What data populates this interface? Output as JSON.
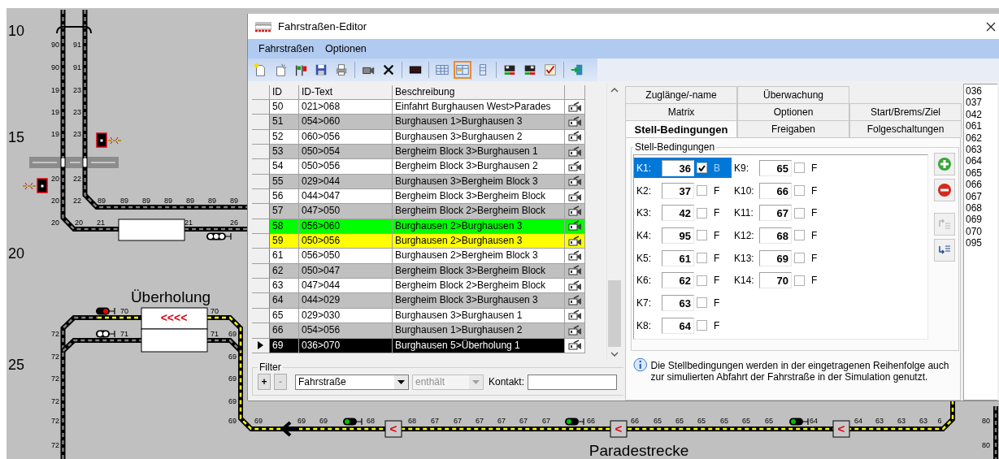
{
  "diagram": {
    "grid_rows": [
      "10",
      "15",
      "20",
      "25"
    ],
    "track_numbers": [
      "90",
      "91",
      "90",
      "91",
      "19",
      "23",
      "19",
      "23",
      "19",
      "23",
      "20",
      "22",
      "20",
      "22",
      "89",
      "89",
      "89",
      "89",
      "89",
      "89",
      "89",
      "20",
      "20",
      "21",
      "21",
      "26",
      "70",
      "70",
      "72",
      "71",
      "71",
      "69",
      "72",
      "69",
      "72",
      "69",
      "72",
      "69",
      "72",
      "69",
      "69",
      "69",
      "69",
      "68",
      "68",
      "67",
      "67",
      "67",
      "67",
      "67",
      "67",
      "66",
      "66",
      "65",
      "65",
      "65",
      "65",
      "65",
      "65",
      "64",
      "64",
      "63",
      "63",
      "63",
      "6",
      "80",
      "72",
      "80"
    ],
    "station_names": [
      "Überholung",
      "Paradestrecke"
    ],
    "route_marker": "<<<<",
    "block_markers": [
      "<",
      "<",
      "<"
    ]
  },
  "window": {
    "title": "Fahrstraßen-Editor"
  },
  "menu": [
    "Fahrstraßen",
    "Optionen"
  ],
  "toolbar": [
    {
      "selected": false
    },
    {
      "selected": false
    },
    {
      "selected": false
    },
    {
      "selected": false
    },
    {
      "selected": false
    },
    {
      "selected": false
    },
    {
      "selected": false
    },
    {
      "selected": false
    },
    {
      "selected": false
    },
    {
      "selected": true
    },
    {
      "selected": false
    },
    {
      "selected": false
    },
    {
      "selected": false
    },
    {
      "selected": false
    },
    {
      "selected": false
    }
  ],
  "table": {
    "columns": [
      "ID",
      "ID-Text",
      "Beschreibung"
    ],
    "rows": [
      {
        "id": "50",
        "id_text": "021>068",
        "description": "Einfahrt Burghausen West>Parades",
        "selected": false
      },
      {
        "id": "51",
        "id_text": "054>060",
        "description": "Burghausen 1>Burghausen 3",
        "selected": false
      },
      {
        "id": "52",
        "id_text": "060>056",
        "description": "Burghausen 3>Burghausen 2",
        "selected": false
      },
      {
        "id": "53",
        "id_text": "050>054",
        "description": "Bergheim Block 3>Burghausen 1",
        "selected": false
      },
      {
        "id": "54",
        "id_text": "050>056",
        "description": "Bergheim Block 3>Burghausen 2",
        "selected": false
      },
      {
        "id": "55",
        "id_text": "029>044",
        "description": "Burghausen 3>Bergheim Block 3",
        "selected": false
      },
      {
        "id": "56",
        "id_text": "044>047",
        "description": "Bergheim Block 3>Bergheim Block",
        "selected": false
      },
      {
        "id": "57",
        "id_text": "047>050",
        "description": "Bergheim Block 2>Bergheim Block",
        "selected": false
      },
      {
        "id": "58",
        "id_text": "056>060",
        "description": "Burghausen 2>Burghausen 3",
        "selected": false,
        "color": "#00ff00"
      },
      {
        "id": "59",
        "id_text": "050>056",
        "description": "Burghausen 2>Burghausen 3",
        "selected": false,
        "color": "#ffff00"
      },
      {
        "id": "61",
        "id_text": "056>050",
        "description": "Burghausen 2>Bergheim Block 3",
        "selected": false
      },
      {
        "id": "62",
        "id_text": "050>047",
        "description": "Bergheim Block 3>Bergheim Block",
        "selected": false
      },
      {
        "id": "63",
        "id_text": "047>044",
        "description": "Bergheim Block 2>Bergheim Block",
        "selected": false
      },
      {
        "id": "64",
        "id_text": "044>029",
        "description": "Bergheim Block 3>Burghausen 3",
        "selected": false
      },
      {
        "id": "65",
        "id_text": "029>030",
        "description": "Burghausen 3>Burghausen 1",
        "selected": false
      },
      {
        "id": "66",
        "id_text": "054>056",
        "description": "Burghausen 1>Burghausen 2",
        "selected": false
      },
      {
        "id": "69",
        "id_text": "036>070",
        "description": "Burghausen 5>Überholung 1",
        "selected": true
      }
    ]
  },
  "filter": {
    "legend": "Filter",
    "add": {
      "label": "+"
    },
    "remove": {
      "label": "-",
      "disabled": true
    },
    "field": {
      "value": "Fahrstraße"
    },
    "operator": {
      "value": "enthält",
      "disabled": true
    },
    "contact": {
      "label": "Kontakt:"
    }
  },
  "tabs": [
    [
      {
        "label": "Zuglänge/-name",
        "selected": false
      },
      {
        "label": "Überwachung",
        "selected": false
      }
    ],
    [
      {
        "label": "Matrix",
        "selected": false
      },
      {
        "label": "Optionen",
        "selected": false
      },
      {
        "label": "Start/Brems/Ziel",
        "selected": false
      }
    ],
    [
      {
        "label": "Stell-Bedingungen",
        "selected": true
      },
      {
        "label": "Freigaben",
        "selected": false
      },
      {
        "label": "Folgeschaltungen",
        "selected": false
      }
    ]
  ],
  "conditions": {
    "title": "Stell-Bedingungen",
    "items": [
      {
        "label": "K1:",
        "value": "36",
        "checked": true,
        "flag": "B",
        "selected": true
      },
      {
        "label": "K2:",
        "value": "37",
        "checked": false,
        "flag": "F",
        "selected": false
      },
      {
        "label": "K3:",
        "value": "42",
        "checked": false,
        "flag": "F",
        "selected": false
      },
      {
        "label": "K4:",
        "value": "95",
        "checked": false,
        "flag": "F",
        "selected": false
      },
      {
        "label": "K5:",
        "value": "61",
        "checked": false,
        "flag": "F",
        "selected": false
      },
      {
        "label": "K6:",
        "value": "62",
        "checked": false,
        "flag": "F",
        "selected": false
      },
      {
        "label": "K7:",
        "value": "63",
        "checked": false,
        "flag": "F",
        "selected": false
      },
      {
        "label": "K8:",
        "value": "64",
        "checked": false,
        "flag": "F",
        "selected": false
      },
      {
        "label": "K9:",
        "value": "65",
        "checked": false,
        "flag": "F",
        "selected": false
      },
      {
        "label": "K10:",
        "value": "66",
        "checked": false,
        "flag": "F",
        "selected": false
      },
      {
        "label": "K11:",
        "value": "67",
        "checked": false,
        "flag": "F",
        "selected": false
      },
      {
        "label": "K12:",
        "value": "68",
        "checked": false,
        "flag": "F",
        "selected": false
      },
      {
        "label": "K13:",
        "value": "69",
        "checked": false,
        "flag": "F",
        "selected": false
      },
      {
        "label": "K14:",
        "value": "70",
        "checked": false,
        "flag": "F",
        "selected": false
      }
    ],
    "side_buttons": [
      {
        "disabled": false
      },
      {
        "disabled": false
      },
      {
        "disabled": true
      },
      {
        "disabled": false
      }
    ],
    "info": "Die Stellbedingungen werden in der eingetragenen Reihenfolge auch zur simulierten Abfahrt der Fahrstraße in der Simulation genutzt."
  },
  "contact_list": [
    "036",
    "037",
    "042",
    "061",
    "062",
    "063",
    "064",
    "065",
    "066",
    "067",
    "068",
    "069",
    "070",
    "095"
  ]
}
